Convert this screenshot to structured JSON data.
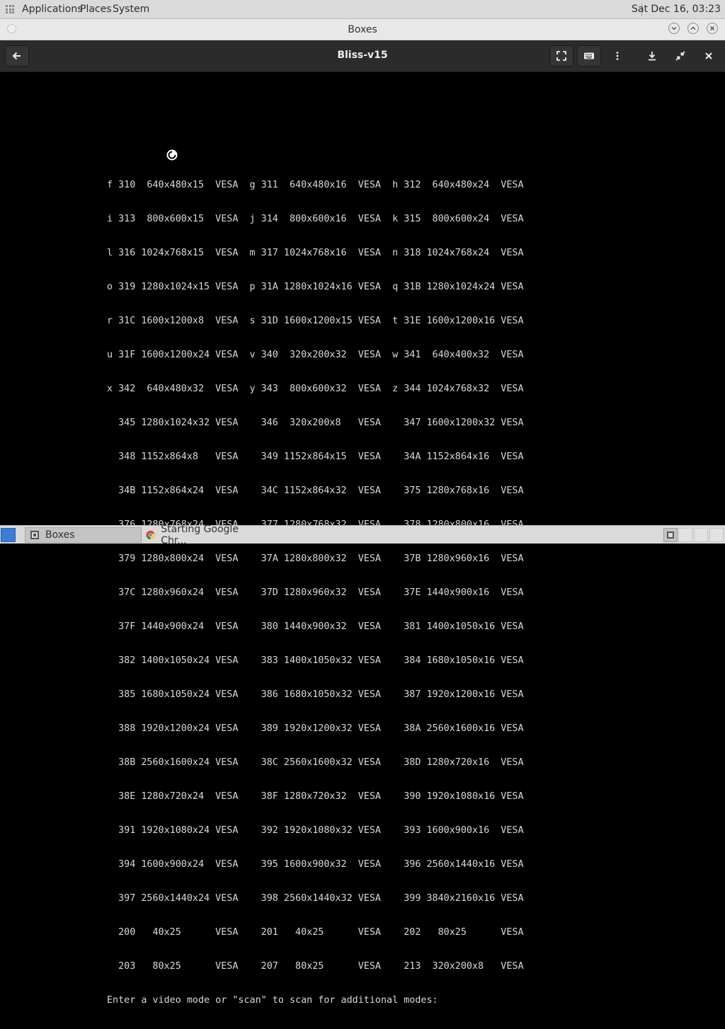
{
  "top_panel": {
    "menus": [
      "Applications",
      "Places",
      "System"
    ],
    "clock": "Sat Dec 16, 03:23"
  },
  "window": {
    "title": "Boxes"
  },
  "headerbar": {
    "title": "Bliss-v15",
    "icons": [
      "back-arrow-icon",
      "fullscreen-icon",
      "keyboard-icon",
      "kebab-menu-icon",
      "download-icon",
      "shrink-icon",
      "close-icon"
    ]
  },
  "console": {
    "lines": [
      "f 310  640x480x15  VESA  g 311  640x480x16  VESA  h 312  640x480x24  VESA",
      "i 313  800x600x15  VESA  j 314  800x600x16  VESA  k 315  800x600x24  VESA",
      "l 316 1024x768x15  VESA  m 317 1024x768x16  VESA  n 318 1024x768x24  VESA",
      "o 319 1280x1024x15 VESA  p 31A 1280x1024x16 VESA  q 31B 1280x1024x24 VESA",
      "r 31C 1600x1200x8  VESA  s 31D 1600x1200x15 VESA  t 31E 1600x1200x16 VESA",
      "u 31F 1600x1200x24 VESA  v 340  320x200x32  VESA  w 341  640x400x32  VESA",
      "x 342  640x480x32  VESA  y 343  800x600x32  VESA  z 344 1024x768x32  VESA",
      "  345 1280x1024x32 VESA    346  320x200x8   VESA    347 1600x1200x32 VESA",
      "  348 1152x864x8   VESA    349 1152x864x15  VESA    34A 1152x864x16  VESA",
      "  34B 1152x864x24  VESA    34C 1152x864x32  VESA    375 1280x768x16  VESA",
      "  376 1280x768x24  VESA    377 1280x768x32  VESA    378 1280x800x16  VESA",
      "  379 1280x800x24  VESA    37A 1280x800x32  VESA    37B 1280x960x16  VESA",
      "  37C 1280x960x24  VESA    37D 1280x960x32  VESA    37E 1440x900x16  VESA",
      "  37F 1440x900x24  VESA    380 1440x900x32  VESA    381 1400x1050x16 VESA",
      "  382 1400x1050x24 VESA    383 1400x1050x32 VESA    384 1680x1050x16 VESA",
      "  385 1680x1050x24 VESA    386 1680x1050x32 VESA    387 1920x1200x16 VESA",
      "  388 1920x1200x24 VESA    389 1920x1200x32 VESA    38A 2560x1600x16 VESA",
      "  38B 2560x1600x24 VESA    38C 2560x1600x32 VESA    38D 1280x720x16  VESA",
      "  38E 1280x720x24  VESA    38F 1280x720x32  VESA    390 1920x1080x16 VESA",
      "  391 1920x1080x24 VESA    392 1920x1080x32 VESA    393 1600x900x16  VESA",
      "  394 1600x900x24  VESA    395 1600x900x32  VESA    396 2560x1440x16 VESA",
      "  397 2560x1440x24 VESA    398 2560x1440x32 VESA    399 3840x2160x16 VESA",
      "  200   40x25      VESA    201   40x25      VESA    202   80x25      VESA",
      "  203   80x25      VESA    207   80x25      VESA    213  320x200x8   VESA",
      "Enter a video mode or \"scan\" to scan for additional modes:"
    ]
  },
  "taskbar": {
    "tasks": [
      {
        "label": "Boxes",
        "icon": "boxes-app-icon"
      },
      {
        "label": "Starting Google Chr...",
        "icon": "chrome-icon"
      }
    ]
  }
}
